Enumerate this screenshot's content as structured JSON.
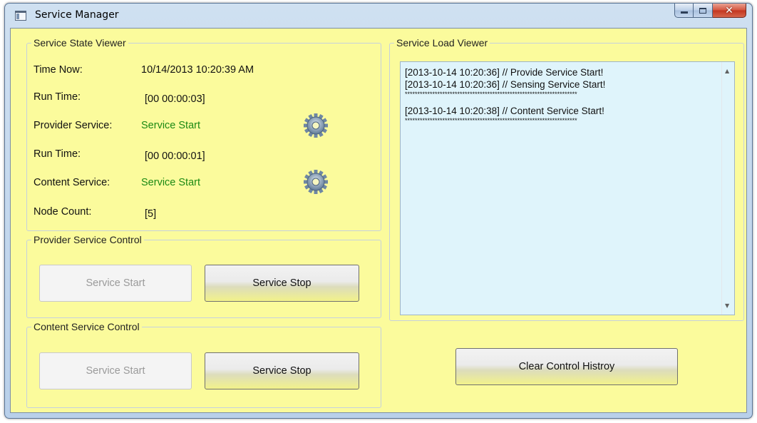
{
  "window": {
    "title": "Service Manager",
    "buttons": {
      "minimize": "minimize",
      "maximize": "maximize",
      "close": "close"
    },
    "background": "#fbfb9c"
  },
  "state_viewer": {
    "title": "Service State Viewer",
    "time_now_label": "Time Now:",
    "time_now_value": "10/14/2013 10:20:39 AM",
    "run_time_label_1": "Run Time:",
    "run_time_value_1": "[00 00:00:03]",
    "provider_label": "Provider Service:",
    "provider_status": "Service Start",
    "run_time_label_2": "Run Time:",
    "run_time_value_2": "[00 00:00:01]",
    "content_label": "Content Service:",
    "content_status": "Service Start",
    "node_count_label": "Node Count:",
    "node_count_value": "[5]",
    "status_color": "#1c8a14",
    "icons": {
      "provider": "gear-icon",
      "content": "gear-icon"
    }
  },
  "provider_control": {
    "title": "Provider Service Control",
    "start_label": "Service Start",
    "stop_label": "Service Stop"
  },
  "content_control": {
    "title": "Content Service Control",
    "start_label": "Service Start",
    "stop_label": "Service Stop"
  },
  "load_viewer": {
    "title": "Service Load Viewer",
    "lines": [
      "[2013-10-14 10:20:36] // Provide Service Start!",
      "[2013-10-14 10:20:36] // Sensing Service Start!",
      "*********************************************************************",
      "[2013-10-14 10:20:38] // Content Service Start!",
      "*********************************************************************"
    ]
  },
  "clear_button": {
    "label": "Clear Control Histroy"
  }
}
